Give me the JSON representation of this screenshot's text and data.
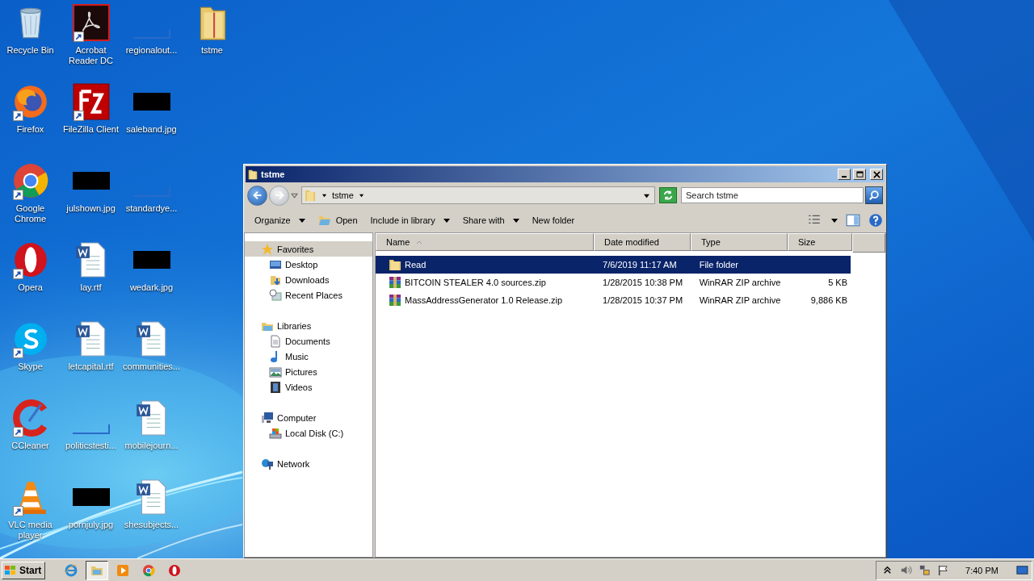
{
  "desktop": {
    "items": [
      {
        "label": "Recycle Bin",
        "kind": "recycle",
        "shortcut": false
      },
      {
        "label": "Firefox",
        "kind": "firefox",
        "shortcut": true
      },
      {
        "label": "Google Chrome",
        "kind": "chrome",
        "shortcut": true
      },
      {
        "label": "Opera",
        "kind": "opera",
        "shortcut": true
      },
      {
        "label": "Skype",
        "kind": "skype",
        "shortcut": true
      },
      {
        "label": "CCleaner",
        "kind": "ccleaner",
        "shortcut": true
      },
      {
        "label": "VLC media player",
        "kind": "vlc",
        "shortcut": true
      },
      {
        "label": "Acrobat Reader DC",
        "kind": "acrobat",
        "shortcut": true
      },
      {
        "label": "FileZilla Client",
        "kind": "filezilla",
        "shortcut": true
      },
      {
        "label": "julshown.jpg",
        "kind": "image-dark",
        "shortcut": false
      },
      {
        "label": "lay.rtf",
        "kind": "document",
        "shortcut": false
      },
      {
        "label": "letcapital.rtf",
        "kind": "document",
        "shortcut": false
      },
      {
        "label": "politicstesti...",
        "kind": "image-blank",
        "shortcut": false
      },
      {
        "label": "pornjuly.jpg",
        "kind": "image-dark",
        "shortcut": false
      },
      {
        "label": "regionalout...",
        "kind": "image-blank",
        "shortcut": false
      },
      {
        "label": "saleband.jpg",
        "kind": "image-dark",
        "shortcut": false
      },
      {
        "label": "standardye...",
        "kind": "image-blank",
        "shortcut": false
      },
      {
        "label": "wedark.jpg",
        "kind": "image-dark",
        "shortcut": false
      },
      {
        "label": "communities...",
        "kind": "document",
        "shortcut": false
      },
      {
        "label": "mobilejourn...",
        "kind": "document",
        "shortcut": false
      },
      {
        "label": "shesubjects...",
        "kind": "document",
        "shortcut": false
      },
      {
        "label": "tstme",
        "kind": "folder",
        "shortcut": false
      }
    ]
  },
  "window": {
    "title": "tstme",
    "address": {
      "breadcrumb": "tstme"
    },
    "search": {
      "placeholder": "Search tstme"
    },
    "toolbar": [
      {
        "label": "Organize",
        "kind": "menu"
      },
      {
        "label": "Open",
        "kind": "open"
      },
      {
        "label": "Include in library",
        "kind": "menu"
      },
      {
        "label": "Share with",
        "kind": "menu"
      },
      {
        "label": "New folder",
        "kind": "button"
      }
    ],
    "navigation": [
      {
        "label": "Favorites",
        "kind": "star",
        "selected": true,
        "children": [
          {
            "label": "Desktop",
            "kind": "desktop",
            "selected": false
          },
          {
            "label": "Downloads",
            "kind": "downloads",
            "selected": false
          },
          {
            "label": "Recent Places",
            "kind": "recent",
            "selected": false
          }
        ]
      },
      {
        "label": "Libraries",
        "kind": "libraries",
        "selected": false,
        "children": [
          {
            "label": "Documents",
            "kind": "documents",
            "selected": false
          },
          {
            "label": "Music",
            "kind": "music",
            "selected": false
          },
          {
            "label": "Pictures",
            "kind": "pictures",
            "selected": false
          },
          {
            "label": "Videos",
            "kind": "videos",
            "selected": false
          }
        ]
      },
      {
        "label": "Computer",
        "kind": "computer",
        "selected": false,
        "children": [
          {
            "label": "Local Disk (C:)",
            "kind": "disk",
            "selected": false
          }
        ]
      },
      {
        "label": "Network",
        "kind": "network",
        "selected": false
      }
    ],
    "table": {
      "columns": [
        {
          "label": "Name",
          "sorted": true
        },
        {
          "label": "Date modified",
          "sorted": false
        },
        {
          "label": "Type",
          "sorted": false
        },
        {
          "label": "Size",
          "sorted": false
        }
      ],
      "rows": [
        {
          "name": "Read",
          "date": "7/6/2019 11:17 AM",
          "type": "File folder",
          "kind": "folder",
          "selected": true
        },
        {
          "name": "BITCOIN STEALER 4.0 sources.zip",
          "date": "1/28/2015 10:38 PM",
          "type": "WinRAR ZIP archive",
          "size": "5 KB",
          "kind": "zip",
          "selected": false
        },
        {
          "name": "MassAddressGenerator 1.0 Release.zip",
          "date": "1/28/2015 10:37 PM",
          "type": "WinRAR ZIP archive",
          "size": "9,886 KB",
          "kind": "zip",
          "selected": false
        }
      ]
    }
  },
  "taskbar": {
    "start": "Start",
    "items": [
      {
        "kind": "ie",
        "active": false
      },
      {
        "kind": "explorer",
        "active": true
      },
      {
        "kind": "media",
        "active": false
      },
      {
        "kind": "chrome",
        "active": false
      },
      {
        "kind": "opera",
        "active": false
      }
    ],
    "clock": "7:40 PM"
  }
}
